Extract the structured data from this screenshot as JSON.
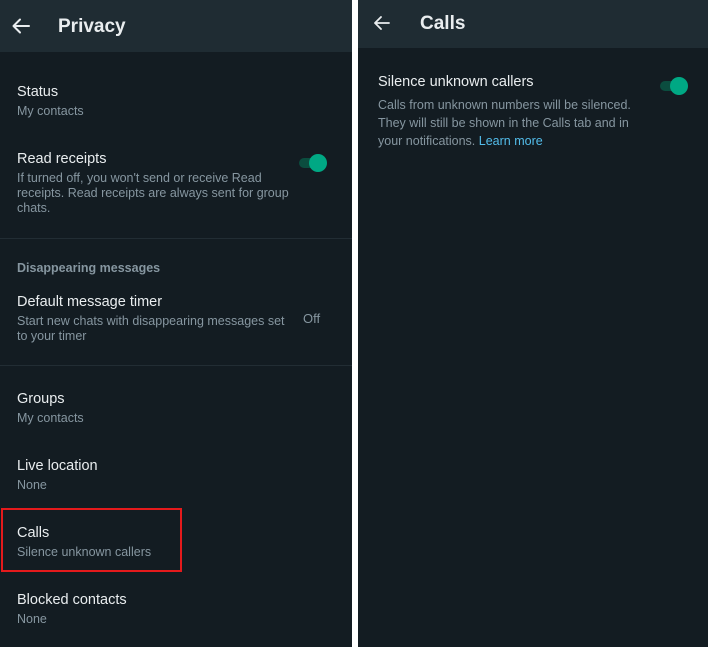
{
  "privacy": {
    "title": "Privacy",
    "status": {
      "label": "Status",
      "value": "My contacts"
    },
    "read_receipts": {
      "label": "Read receipts",
      "description_lines": [
        "If turned off, you won't send or receive Read",
        "receipts. Read receipts are always sent for group",
        "chats."
      ],
      "enabled": true
    },
    "disappearing_section": "Disappearing messages",
    "default_timer": {
      "label": "Default message timer",
      "description_lines": [
        "Start new chats with disappearing messages set",
        "to your timer"
      ],
      "value": "Off"
    },
    "groups": {
      "label": "Groups",
      "value": "My contacts"
    },
    "live_location": {
      "label": "Live location",
      "value": "None"
    },
    "calls": {
      "label": "Calls",
      "value": "Silence unknown callers"
    },
    "blocked_contacts": {
      "label": "Blocked contacts",
      "value": "None"
    }
  },
  "calls_screen": {
    "title": "Calls",
    "silence_unknown": {
      "label": "Silence unknown callers",
      "description_lines": [
        "Calls from unknown numbers will be silenced.",
        "They will still be shown in the Calls tab and in",
        "your notifications."
      ],
      "learn_more": "Learn more",
      "enabled": true
    }
  },
  "colors": {
    "background": "#131c22",
    "app_bar": "#1f2c33",
    "primary_text": "#e9edef",
    "secondary_text": "#8696a0",
    "accent": "#00a884",
    "link": "#53bdeb",
    "highlight": "#e41a1c"
  },
  "icons": {
    "back": "arrow-left-icon",
    "toggle": "toggle-switch-icon"
  }
}
